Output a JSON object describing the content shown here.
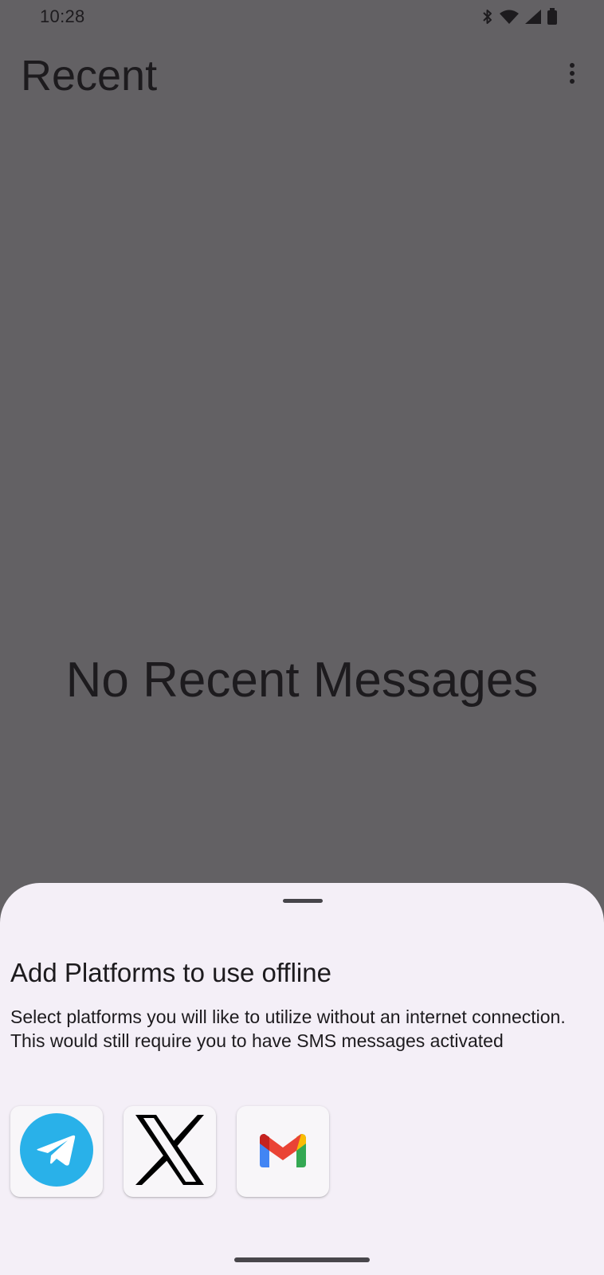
{
  "status_bar": {
    "time": "10:28",
    "icons": [
      "bluetooth-icon",
      "wifi-icon",
      "signal-icon",
      "battery-icon"
    ]
  },
  "app_bar": {
    "title": "Recent",
    "menu_icon": "more-vert-icon"
  },
  "empty_state": {
    "text": "No Recent Messages"
  },
  "bottom_sheet": {
    "title": "Add Platforms to use offline",
    "description": "Select platforms you will like to utilize without an internet connection. This would still require you to have SMS messages activated",
    "platforms": [
      {
        "icon": "telegram-icon",
        "color": "#29b1e9"
      },
      {
        "icon": "x-icon",
        "color": "#000000"
      },
      {
        "icon": "gmail-icon",
        "color": "#ea4335"
      }
    ]
  },
  "colors": {
    "scrim_background": "#636164",
    "sheet_background": "#f4eff7",
    "text_primary": "#1d1b1e"
  }
}
